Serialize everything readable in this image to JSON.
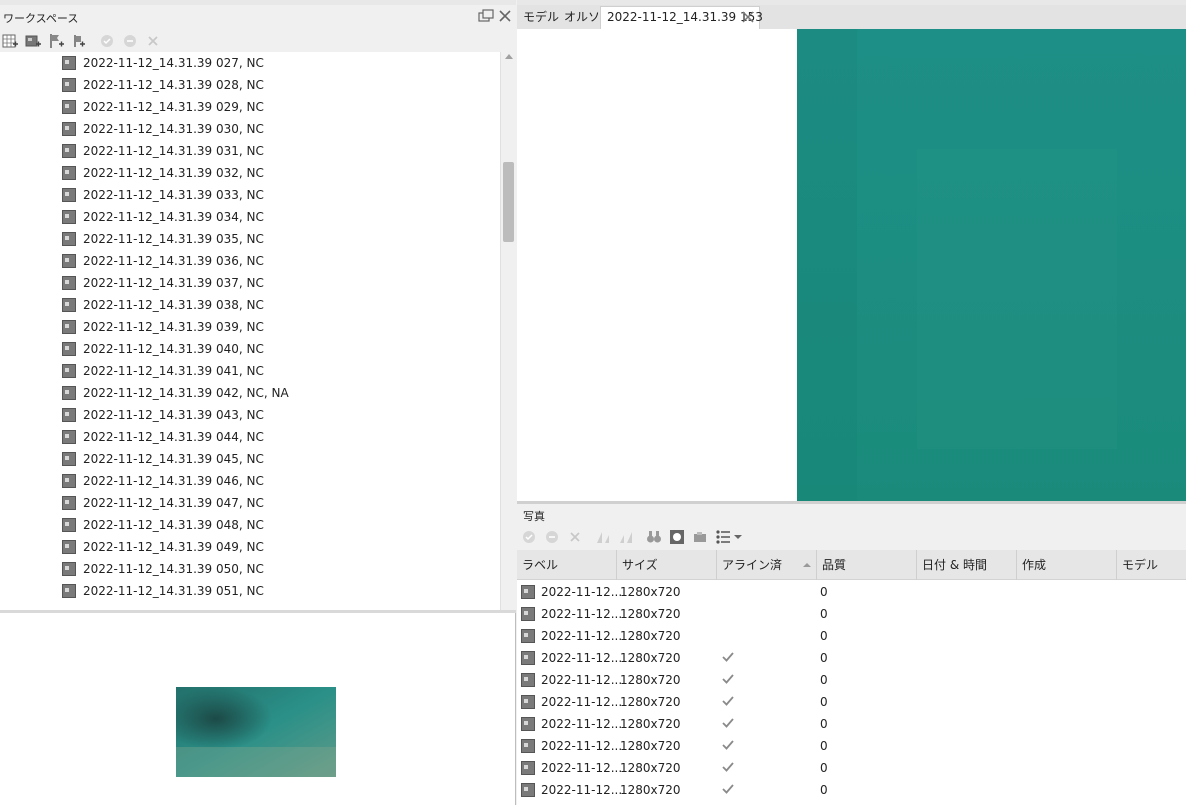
{
  "workspace": {
    "title": "ワークスペース",
    "items": [
      "2022-11-12_14.31.39 027, NC",
      "2022-11-12_14.31.39 028, NC",
      "2022-11-12_14.31.39 029, NC",
      "2022-11-12_14.31.39 030, NC",
      "2022-11-12_14.31.39 031, NC",
      "2022-11-12_14.31.39 032, NC",
      "2022-11-12_14.31.39 033, NC",
      "2022-11-12_14.31.39 034, NC",
      "2022-11-12_14.31.39 035, NC",
      "2022-11-12_14.31.39 036, NC",
      "2022-11-12_14.31.39 037, NC",
      "2022-11-12_14.31.39 038, NC",
      "2022-11-12_14.31.39 039, NC",
      "2022-11-12_14.31.39 040, NC",
      "2022-11-12_14.31.39 041, NC",
      "2022-11-12_14.31.39 042, NC, NA",
      "2022-11-12_14.31.39 043, NC",
      "2022-11-12_14.31.39 044, NC",
      "2022-11-12_14.31.39 045, NC",
      "2022-11-12_14.31.39 046, NC",
      "2022-11-12_14.31.39 047, NC",
      "2022-11-12_14.31.39 048, NC",
      "2022-11-12_14.31.39 049, NC",
      "2022-11-12_14.31.39 050, NC",
      "2022-11-12_14.31.39 051, NC"
    ],
    "toolbar_icons": [
      "add-chunk-icon",
      "add-photos-icon",
      "add-marker-icon",
      "add-folder-icon",
      "enable-icon",
      "disable-icon",
      "remove-icon"
    ]
  },
  "viewer": {
    "tabs": {
      "model": "モデル",
      "ortho": "オルソ",
      "photo": "2022-11-12_14.31.39 153"
    },
    "image_color": "#1b8c80"
  },
  "photos": {
    "title": "写真",
    "columns": [
      "ラベル",
      "サイズ",
      "アライン済",
      "品質",
      "日付 & 時間",
      "作成",
      "モデル"
    ],
    "rows": [
      {
        "label": "2022-11-12...",
        "size": "1280x720",
        "aligned": false,
        "quality": "0"
      },
      {
        "label": "2022-11-12...",
        "size": "1280x720",
        "aligned": false,
        "quality": "0"
      },
      {
        "label": "2022-11-12...",
        "size": "1280x720",
        "aligned": false,
        "quality": "0"
      },
      {
        "label": "2022-11-12...",
        "size": "1280x720",
        "aligned": true,
        "quality": "0"
      },
      {
        "label": "2022-11-12...",
        "size": "1280x720",
        "aligned": true,
        "quality": "0"
      },
      {
        "label": "2022-11-12...",
        "size": "1280x720",
        "aligned": true,
        "quality": "0"
      },
      {
        "label": "2022-11-12...",
        "size": "1280x720",
        "aligned": true,
        "quality": "0"
      },
      {
        "label": "2022-11-12...",
        "size": "1280x720",
        "aligned": true,
        "quality": "0"
      },
      {
        "label": "2022-11-12...",
        "size": "1280x720",
        "aligned": true,
        "quality": "0"
      },
      {
        "label": "2022-11-12...",
        "size": "1280x720",
        "aligned": true,
        "quality": "0"
      }
    ]
  }
}
